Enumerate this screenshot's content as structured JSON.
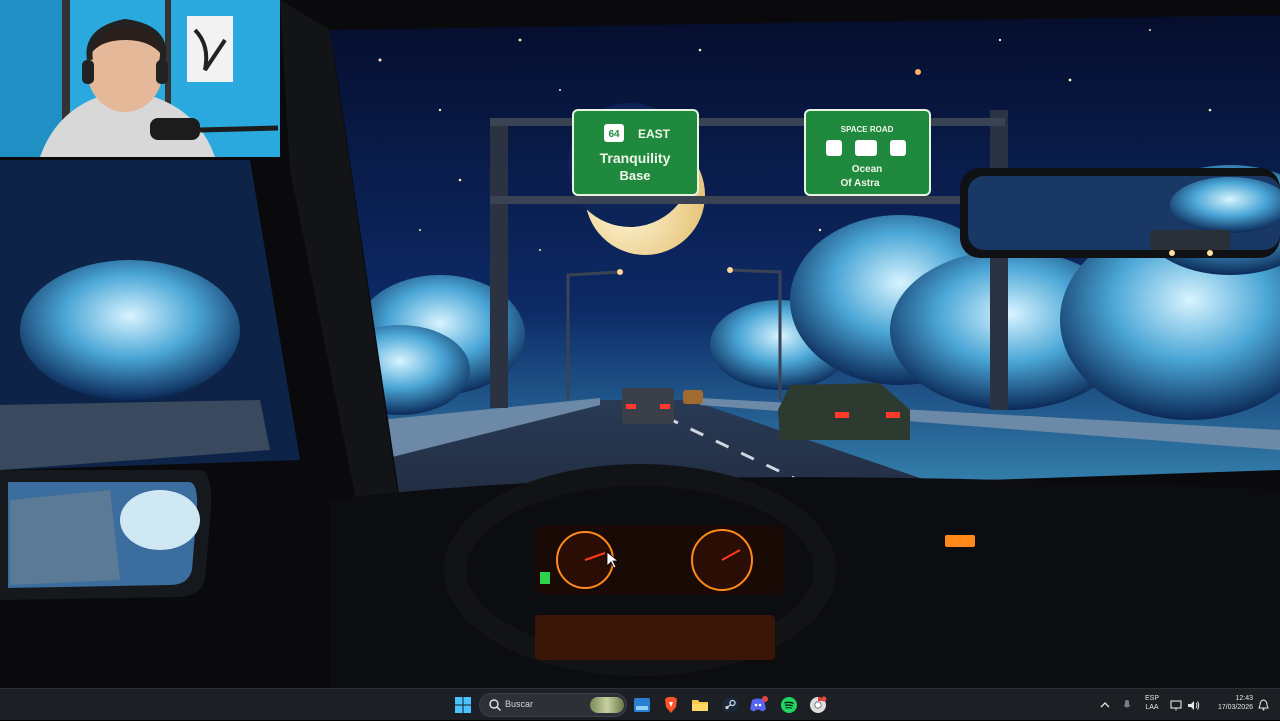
{
  "taskbar": {
    "search_label": "Buscar",
    "pinned_apps": [
      "start-icon",
      "search-icon",
      "widgets-icon",
      "brave-icon",
      "file-explorer-icon",
      "steam-icon",
      "discord-icon",
      "spotify-icon",
      "chrome-icon"
    ],
    "discord_badge": "●"
  },
  "tray": {
    "lang_line1": "ESP",
    "lang_line2": "LAA",
    "time": "12:43",
    "date": "17/03/2026"
  },
  "wallpaper": {
    "sign_left_route": "64",
    "sign_left_direction": "EAST",
    "sign_left_line1": "Tranquility",
    "sign_left_line2": "Base",
    "sign_right_top": "SPACE ROAD",
    "sign_right_line1": "Ocean",
    "sign_right_line2": "Of Astra"
  },
  "colors": {
    "sky": "#0a1a4a",
    "sign_green": "#1f8a3e",
    "taskbar": "#1c1f24",
    "dashboard_amber": "#ff8a1a"
  }
}
